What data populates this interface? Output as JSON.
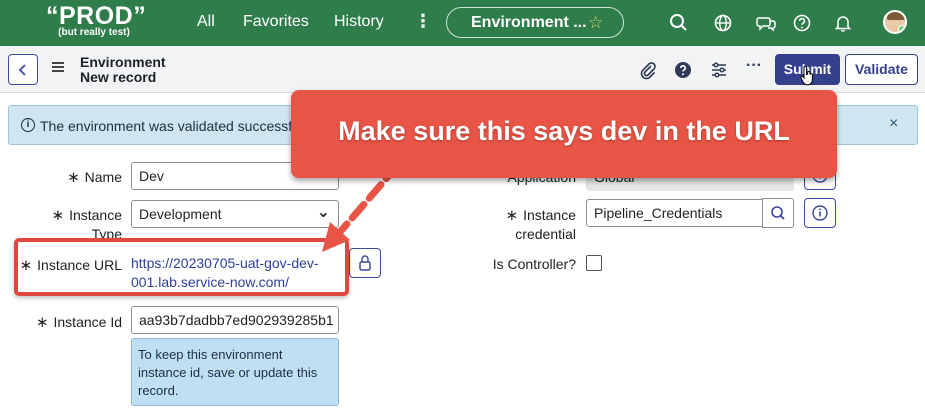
{
  "nav": {
    "logo_big": "“PROD”",
    "logo_small": "(but really test)",
    "links": [
      "All",
      "Favorites",
      "History"
    ],
    "more": "⋮",
    "pill_title": "Environment ...",
    "icons": [
      "search-icon",
      "globe-icon",
      "chat-icon",
      "help-icon",
      "bell-icon"
    ]
  },
  "header": {
    "title_line1": "Environment",
    "title_line2": "New record",
    "more": "···",
    "submit_label": "Submit",
    "validate_label": "Validate"
  },
  "banner": {
    "message": "The environment was validated successful",
    "close": "×"
  },
  "form": {
    "name_label": "Name",
    "name_value": "Dev",
    "type_label_line1": "Instance",
    "type_label_line2": "Type",
    "type_value": "Development",
    "url_label": "Instance URL",
    "url_value": "https://20230705-uat-gov-dev-001.lab.service-now.com/",
    "id_label": "Instance Id",
    "id_value": "aa93b7dadbb7ed902939285b1",
    "id_hint": "To keep this environment instance id, save or update this record.",
    "application_label": "Application",
    "application_value": "Global",
    "credential_label_line1": "Instance",
    "credential_label_line2": "credential",
    "credential_value": "Pipeline_Credentials",
    "controller_label": "Is Controller?",
    "controller_checked": false,
    "required_mark": "∗"
  },
  "annotation": {
    "callout_text": "Make sure this says dev in the URL",
    "color": "#e85445"
  }
}
